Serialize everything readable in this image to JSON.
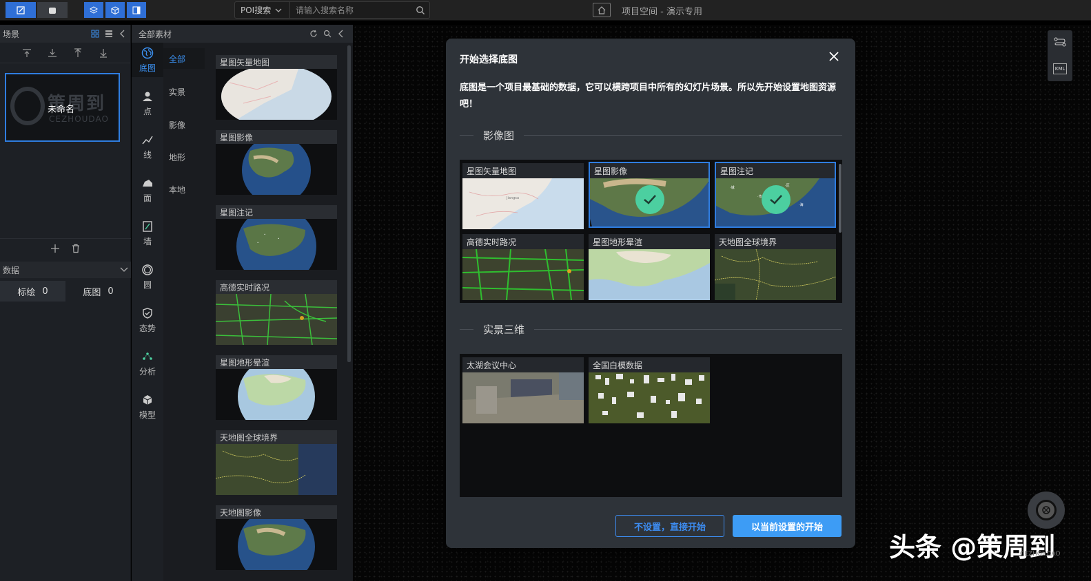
{
  "topbar": {
    "poi_select": "POI搜索",
    "search_placeholder": "请输入搜索名称",
    "project_title": "项目空间 - 演示专用"
  },
  "scene_panel": {
    "title": "场景",
    "scene_name": "未命名",
    "logo_text": "策周到",
    "logo_sub": "CEZHOUDAO",
    "data_title": "数据",
    "tabs": [
      {
        "label": "标绘",
        "count": "0"
      },
      {
        "label": "底图",
        "count": "0"
      }
    ]
  },
  "material_panel": {
    "title": "全部素材",
    "categories": [
      {
        "label": "底图",
        "icon": "globe-icon"
      },
      {
        "label": "点",
        "icon": "point-icon"
      },
      {
        "label": "线",
        "icon": "line-icon"
      },
      {
        "label": "面",
        "icon": "polygon-icon"
      },
      {
        "label": "墙",
        "icon": "wall-icon"
      },
      {
        "label": "圆",
        "icon": "circle-icon"
      },
      {
        "label": "态势",
        "icon": "shield-icon"
      },
      {
        "label": "分析",
        "icon": "analysis-icon"
      },
      {
        "label": "模型",
        "icon": "model-icon"
      }
    ],
    "subcategories": [
      "全部",
      "实景",
      "影像",
      "地形",
      "本地"
    ],
    "thumbs": [
      "星图矢量地图",
      "星图影像",
      "星图注记",
      "高德实时路况",
      "星图地形晕渲",
      "天地图全球境界",
      "天地图影像"
    ]
  },
  "modal": {
    "title": "开始选择底图",
    "description": "底图是一个项目最基础的数据，它可以横跨项目中所有的幻灯片场景。所以先开始设置地图资源吧！",
    "section_imagery": "影像图",
    "section_3d": "实景三维",
    "imagery_items": [
      {
        "label": "星图矢量地图",
        "selected": false
      },
      {
        "label": "星图影像",
        "selected": true
      },
      {
        "label": "星图注记",
        "selected": true
      },
      {
        "label": "高德实时路况",
        "selected": false
      },
      {
        "label": "星图地形晕渲",
        "selected": false
      },
      {
        "label": "天地图全球境界",
        "selected": false
      }
    ],
    "realscene_items": [
      {
        "label": "太湖会议中心"
      },
      {
        "label": "全国白模数据"
      }
    ],
    "btn_skip": "不设置，直接开始",
    "btn_start": "以当前设置的开始"
  },
  "map": {
    "kml_label": "KML",
    "watermark": "头条 @策周到",
    "watermark_sub": "CEZHOUDAO"
  },
  "colors": {
    "accent": "#3d9cf5",
    "check": "#4ccfa0",
    "selected_border": "#2f7de0"
  }
}
